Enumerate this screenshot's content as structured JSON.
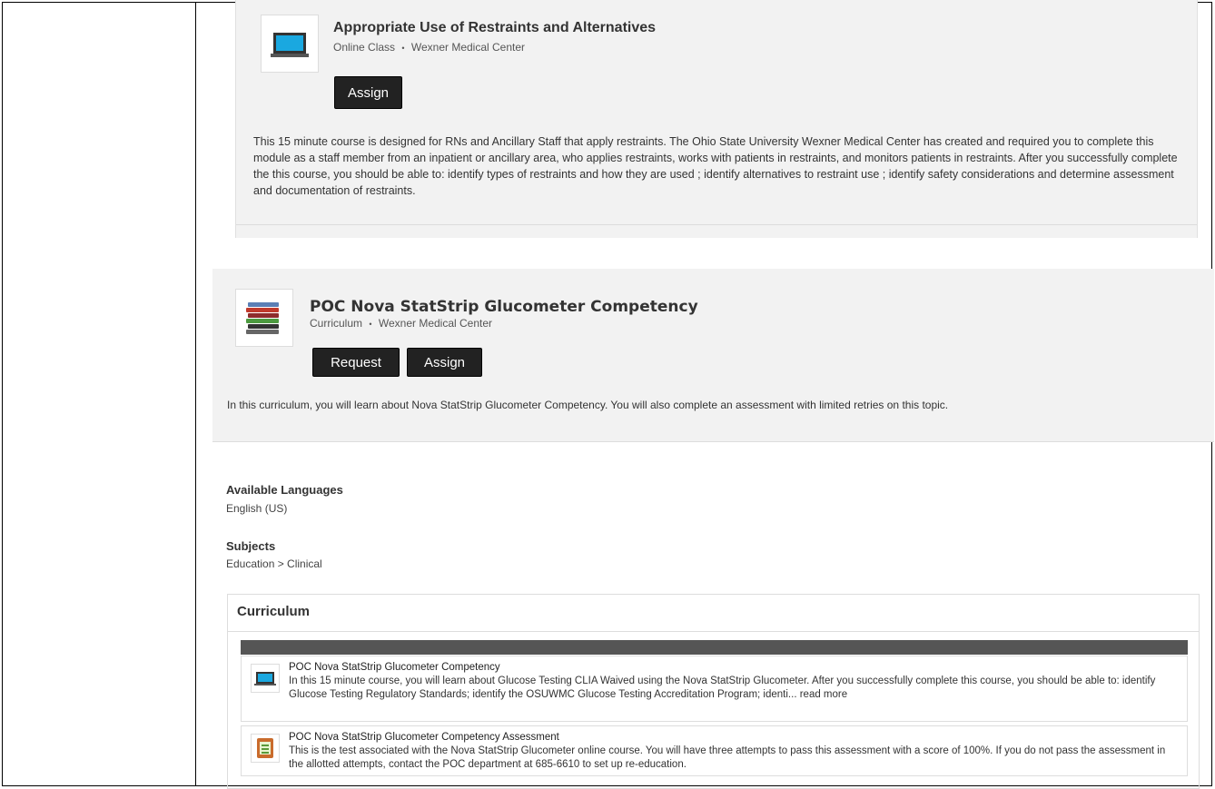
{
  "course1": {
    "title": "Appropriate Use of Restraints and Alternatives",
    "type": "Online Class",
    "separator": "•",
    "provider": "Wexner Medical Center",
    "assign_label": "Assign",
    "description": "This 15 minute course is designed for RNs and Ancillary Staff that apply restraints. The Ohio State University Wexner Medical Center has created and required you to complete this module as a staff member from an inpatient or ancillary area, who applies restraints, works with patients in restraints, and monitors patients in restraints. After you successfully complete the this course, you should be able to: identify types of restraints and how they are used ; identify alternatives to restraint use ; identify safety considerations and determine assessment and documentation of restraints."
  },
  "course2": {
    "title": "POC Nova StatStrip Glucometer Competency",
    "type": "Curriculum",
    "separator": "•",
    "provider": "Wexner Medical Center",
    "request_label": "Request",
    "assign_label": "Assign",
    "description": "In this curriculum, you will learn about Nova StatStrip Glucometer Competency. You will also complete an assessment with limited retries on this topic."
  },
  "details": {
    "languages_label": "Available Languages",
    "languages_value": "English (US)",
    "subjects_label": "Subjects",
    "subjects_value": "Education > Clinical"
  },
  "curriculum": {
    "heading": "Curriculum",
    "items": [
      {
        "title": "POC Nova StatStrip Glucometer Competency",
        "description": "In this 15 minute course, you will learn about Glucose Testing CLIA Waived using the Nova StatStrip Glucometer. After you successfully complete this course, you should be able to: identify Glucose Testing Regulatory Standards; identify the OSUWMC Glucose Testing Accreditation Program; identi...",
        "read_more": "read more",
        "icon": "laptop-icon"
      },
      {
        "title": "POC Nova StatStrip Glucometer Competency Assessment",
        "description": "This is the test associated with the Nova StatStrip Glucometer online course. You will have three attempts to pass this assessment with a score of 100%. If you do not pass the assessment in the allotted attempts, contact the POC department at 685-6610 to set up re-education.",
        "icon": "test-sheet-icon"
      }
    ]
  }
}
